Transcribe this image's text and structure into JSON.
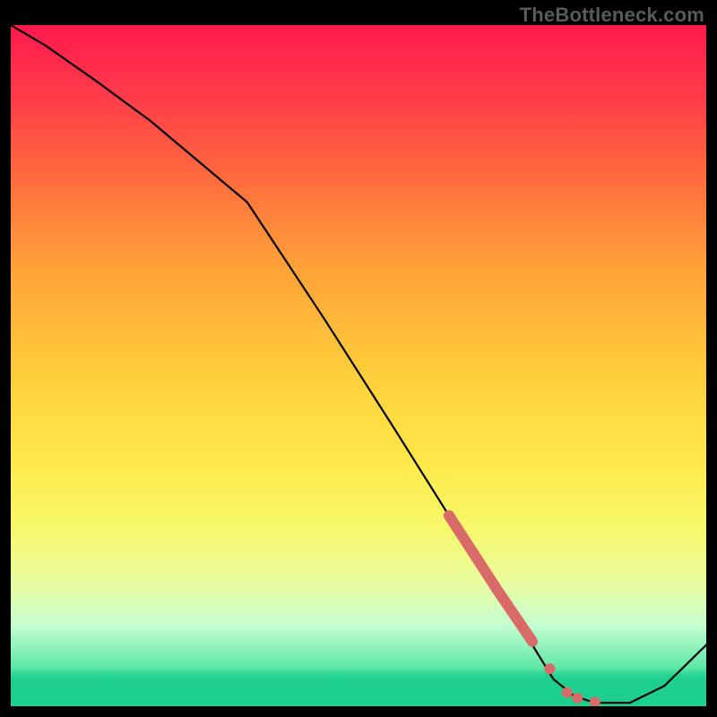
{
  "watermark": "TheBottleneck.com",
  "colors": {
    "curve": "#000000",
    "marker": "#d86a67",
    "plot_border": "#000000"
  },
  "chart_data": {
    "type": "line",
    "title": "",
    "xlabel": "",
    "ylabel": "",
    "xlim": [
      0,
      100
    ],
    "ylim": [
      0,
      100
    ],
    "series": [
      {
        "name": "curve",
        "x": [
          0,
          5,
          12,
          20,
          27,
          34,
          45,
          55,
          63,
          70,
          75,
          78,
          81,
          84,
          89,
          94,
          100
        ],
        "y": [
          100,
          97,
          92,
          86,
          80,
          74,
          57,
          41,
          28,
          17,
          9,
          4,
          1.5,
          0.5,
          0.5,
          3,
          9
        ]
      }
    ],
    "markers": [
      {
        "name": "thick-segment",
        "type": "line",
        "x": [
          63,
          70,
          75
        ],
        "y": [
          28,
          17,
          9.5
        ]
      },
      {
        "name": "dot-a",
        "type": "dot",
        "x": 77.5,
        "y": 5.5
      },
      {
        "name": "dot-b",
        "type": "dot",
        "x": 80.0,
        "y": 2.0
      },
      {
        "name": "dot-c",
        "type": "dot",
        "x": 81.5,
        "y": 1.2
      },
      {
        "name": "dot-d",
        "type": "dot",
        "x": 84.0,
        "y": 0.6
      }
    ],
    "background": {
      "type": "vertical-gradient",
      "stops": [
        {
          "pos": 0.0,
          "color": "#ff1a4e"
        },
        {
          "pos": 0.5,
          "color": "#ffd03a"
        },
        {
          "pos": 0.75,
          "color": "#f7f86a"
        },
        {
          "pos": 0.94,
          "color": "#5fe8a6"
        },
        {
          "pos": 1.0,
          "color": "#1ccf8f"
        }
      ]
    }
  }
}
